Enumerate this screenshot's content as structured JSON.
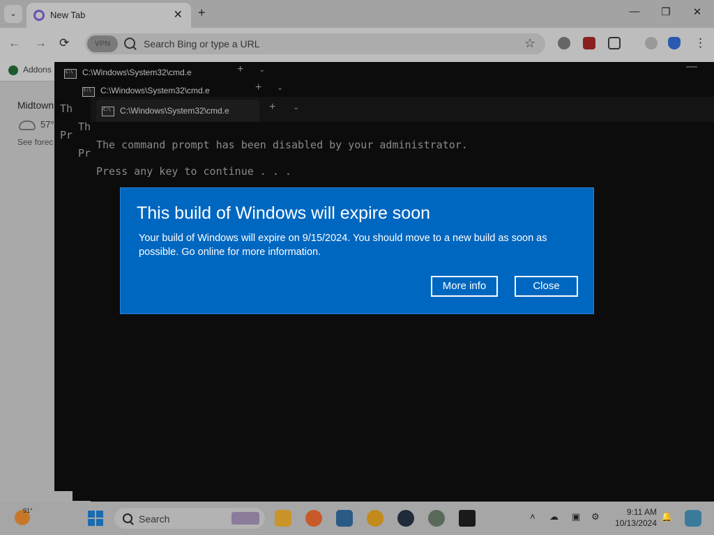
{
  "browser": {
    "tab_title": "New Tab",
    "address_placeholder": "Search Bing or type a URL",
    "vpn_label": "VPN",
    "bookmark_label": "Addons",
    "weather": {
      "location": "Midtown",
      "temp": "57°",
      "link": "See forec"
    }
  },
  "terminals": [
    {
      "title": "C:\\Windows\\System32\\cmd.e",
      "lines": [
        "Th",
        "Pr"
      ]
    },
    {
      "title": "C:\\Windows\\System32\\cmd.e",
      "lines": [
        "Th",
        "Pr"
      ]
    },
    {
      "title": "C:\\Windows\\System32\\cmd.e",
      "lines": [
        "The command prompt has been disabled by your administrator.",
        "Press any key to continue . . ."
      ]
    }
  ],
  "dialog": {
    "title": "This build of Windows will expire soon",
    "body": "Your build of Windows will expire on 9/15/2024. You should move to a new build as soon as possible. Go online for more information.",
    "more_info": "More info",
    "close": "Close"
  },
  "taskbar": {
    "weather_temp": "91°",
    "search_placeholder": "Search",
    "time": "9:11 AM",
    "date": "10/13/2024"
  },
  "colors": {
    "dialog_bg": "#0067c0",
    "terminal_bg": "#0c0c0c"
  }
}
